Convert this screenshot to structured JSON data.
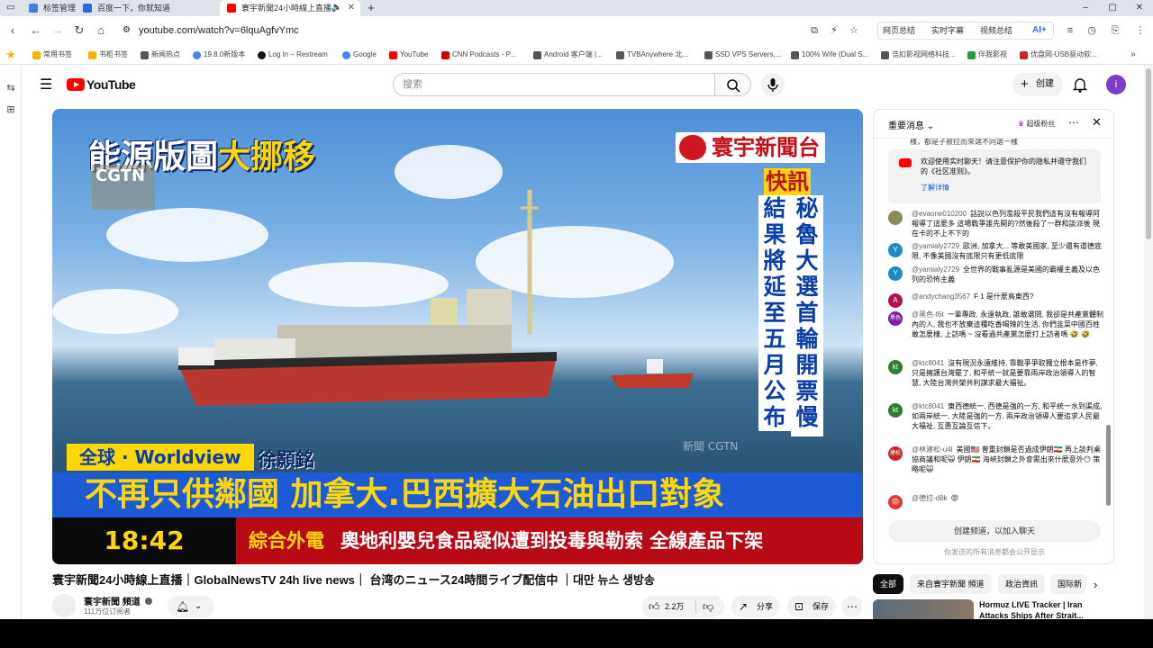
{
  "browser": {
    "tabs": [
      {
        "label": "标签管理",
        "icon_color": "#4a7bd0"
      },
      {
        "label": "百度一下，你就知道",
        "icon_color": "#3367d6"
      },
      {
        "label": "寰宇新聞24小時線上直播",
        "icon_color": "#ff0000"
      }
    ],
    "new_tab": "+",
    "url": "youtube.com/watch?v=6lquAgfvYmc",
    "toolbar_buttons": [
      "网页总结",
      "实时字幕",
      "视频总结",
      "AI+"
    ],
    "bookmarks": [
      {
        "label": "常用书签",
        "color": "#f4b400"
      },
      {
        "label": "书柜书签",
        "color": "#f4b400"
      },
      {
        "label": "新闻热点",
        "color": "#555555"
      },
      {
        "label": "19.8.0新版本",
        "color": "#4285f4"
      },
      {
        "label": "Log In – Restream",
        "color": "#111111"
      },
      {
        "label": "Google",
        "color": "#4285f4"
      },
      {
        "label": "YouTube",
        "color": "#ff0000"
      },
      {
        "label": "CNN Podcasts - P...",
        "color": "#cc0000"
      },
      {
        "label": "Android 客户端 |...",
        "color": "#555555"
      },
      {
        "label": "TVBAnywhere 北...",
        "color": "#555555"
      },
      {
        "label": "SSD VPS Servers,...",
        "color": "#555555"
      },
      {
        "label": "100% Wife (Dual S...",
        "color": "#555555"
      },
      {
        "label": "浩扣影视网络科技...",
        "color": "#555555"
      },
      {
        "label": "伴我影视",
        "color": "#2e9a3f"
      },
      {
        "label": "优盘网-USB驱动软...",
        "color": "#c62828"
      }
    ]
  },
  "youtube": {
    "logo_text": "YouTube",
    "search_placeholder": "搜索",
    "create_label": "创建",
    "avatar_letter": "i",
    "accent": "#ff0000"
  },
  "video": {
    "overlay_title_white": "能源版圖",
    "overlay_title_yellow": "大挪移",
    "cgtn": "CGTN",
    "brand": "寰宇新聞台",
    "flash": "快訊",
    "vertical_col1": "結果將延至五月公布",
    "vertical_col2": "秘魯大選首輪開票慢",
    "world_tag": "全球 · Worldview",
    "reporter": "徐顥銘",
    "headline": "不再只供鄰國 加拿大.巴西擴大石油出口對象",
    "clock": "18:42",
    "ticker_tag": "綜合外電",
    "ticker_text": "奧地利嬰兒食品疑似遭到投毒與勒索 全線產品下架",
    "watermark": "新聞 CGTN"
  },
  "below": {
    "title": "寰宇新聞24小時線上直播｜GlobalNewsTV 24h live news｜ 台湾のニュース24時間ライブ配信中 ｜대만 뉴스 생방송",
    "channel_name": "寰宇新聞 頻道",
    "subscribers": "111万位订阅者",
    "likes": "2.2万",
    "share": "分享",
    "save": "保存"
  },
  "chat": {
    "header": "重要消息",
    "super_fan": "超级粉丝",
    "top_cut": "樣，都是子被拉而來選不同選一樣",
    "notice": "欢迎使用实时聊天！请注意保护你的隐私并遵守我们的《社区准则》。",
    "notice_link": "了解详情",
    "messages": [
      {
        "author": "@evaone010200",
        "text": "話說以色列濫殺平民我們這有沒有報導阿 報導了這麼多 這場戰爭誰先開的?然後殺了一群和談派後 現在卡的不上不下的",
        "avatar": "",
        "color": "#8a8a5a"
      },
      {
        "author": "@yamialy2729",
        "text": "歐洲, 加拿大... 等敢美國家, 至少還有道德底限, 不像美國沒有底限只有更低底限",
        "avatar": "Y",
        "color": "#1e88c9"
      },
      {
        "author": "@yamialy2729",
        "text": "全世界的戰事亂源是美國的霸權主義及以色列的恐怖主義",
        "avatar": "Y",
        "color": "#1e88c9"
      },
      {
        "author": "@andychang3567",
        "text": "F 1 是什麼鳥東西?",
        "avatar": "A",
        "color": "#b0124f"
      },
      {
        "author": "@黑色-f6t",
        "text": "一輩專政, 永遠執政, 誰敢選問, 我卻是共產黨體制內的人, 我也不放棄這種吃香喝辣的生活, 你們韭菜中國百姓敢怎麼樣, 上訪嗎 ~ 沒看過共產黨怎麼打上訪者嗎 🤣 🤣",
        "avatar": "黑色",
        "color": "#7b1fa2"
      },
      {
        "author": "@ktc8041",
        "text": "沒有現況永遠維持, 靠戰爭爭取獨立根本是作夢, 只是擁護台灣罷了, 和平統一就是要靠兩岸政治領導人的智慧, 大陸台灣共榮共利謀求最大福祉。",
        "avatar": "kt",
        "color": "#2e7d32"
      },
      {
        "author": "@ktc8041",
        "text": "東西德統一, 西德是強的一方, 和平統一水到渠成, 如兩岸統一, 大陸是強的一方, 兩岸政治領導人要追求人民最大福祉, 互惠互論互信下。",
        "avatar": "kt",
        "color": "#2e7d32"
      },
      {
        "author": "@林建松-u4l",
        "text": "美國🇺🇸 曾重封鎖是否過成伊朗🇮🇷 再上談判桌協商議和呢🙀 伊朗🇮🇷 海峽封鎖之外會需出來什麼意外😶 策略呢🙀",
        "avatar": "建松",
        "color": "#c62828"
      },
      {
        "author": "@德拉-d8k",
        "text": "😡",
        "avatar": "😡",
        "color": "#e53935"
      }
    ],
    "input_placeholder": "创建频道，以加入聊天",
    "footer": "你发送的所有消息都会公开显示"
  },
  "related": {
    "chips": [
      "全部",
      "来自寰宇新聞 頻道",
      "政治資訊",
      "国际新"
    ],
    "first_title": "Hormuz LIVE Tracker | Iran Attacks Ships After Strait..."
  }
}
